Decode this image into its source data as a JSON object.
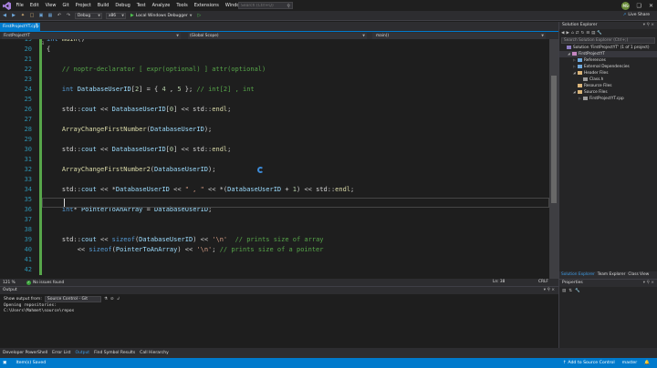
{
  "menu": {
    "items": [
      "File",
      "Edit",
      "View",
      "Git",
      "Project",
      "Build",
      "Debug",
      "Test",
      "Analyze",
      "Tools",
      "Extensions",
      "Window",
      "Help"
    ],
    "search_placeholder": "Search (Ctrl+Q)",
    "avatar_initials": "MS"
  },
  "toolbar": {
    "config": "Debug",
    "platform": "x86",
    "run_label": "Local Windows Debugger",
    "live_share": "Live Share"
  },
  "editor": {
    "tab_title": "FirstProjectYT.cpp",
    "nav_project": "FirstProjectYT",
    "nav_scope": "(Global Scope)",
    "nav_member": "main()",
    "zoom": "121 %",
    "issues": "No issues found",
    "position": "Ln: 38",
    "eol": "CRLF"
  },
  "code_lines": [
    {
      "n": "19",
      "changed": true,
      "tokens": [
        [
          "kw",
          "int "
        ],
        [
          "fn",
          "main"
        ],
        [
          "pl",
          "()"
        ]
      ]
    },
    {
      "n": "20",
      "changed": true,
      "tokens": [
        [
          "pl",
          "{"
        ]
      ]
    },
    {
      "n": "21",
      "changed": true,
      "tokens": []
    },
    {
      "n": "22",
      "changed": true,
      "tokens": [
        [
          "cmt",
          "    // noptr-declarator [ expr(optional) ] attr(optional)"
        ]
      ]
    },
    {
      "n": "23",
      "changed": true,
      "tokens": []
    },
    {
      "n": "24",
      "changed": true,
      "tokens": [
        [
          "kw",
          "    int "
        ],
        [
          "var",
          "DatabaseUserID"
        ],
        [
          "pl",
          "["
        ],
        [
          "num",
          "2"
        ],
        [
          "pl",
          "] = { "
        ],
        [
          "num",
          "4"
        ],
        [
          "pl",
          " , "
        ],
        [
          "num",
          "5"
        ],
        [
          "pl",
          " }; "
        ],
        [
          "cmt",
          "// int[2] , int"
        ]
      ]
    },
    {
      "n": "25",
      "changed": true,
      "tokens": []
    },
    {
      "n": "26",
      "changed": true,
      "tokens": [
        [
          "pl",
          "    std::"
        ],
        [
          "var",
          "cout"
        ],
        [
          "pl",
          " << "
        ],
        [
          "var",
          "DatabaseUserID"
        ],
        [
          "pl",
          "["
        ],
        [
          "num",
          "0"
        ],
        [
          "pl",
          "] << std::"
        ],
        [
          "fn",
          "endl"
        ],
        [
          "pl",
          ";"
        ]
      ]
    },
    {
      "n": "27",
      "changed": true,
      "tokens": []
    },
    {
      "n": "28",
      "changed": true,
      "tokens": [
        [
          "fn",
          "    ArrayChangeFirstNumber"
        ],
        [
          "pl",
          "("
        ],
        [
          "var",
          "DatabaseUserID"
        ],
        [
          "pl",
          ");"
        ]
      ]
    },
    {
      "n": "29",
      "changed": true,
      "tokens": []
    },
    {
      "n": "30",
      "changed": true,
      "tokens": [
        [
          "pl",
          "    std::"
        ],
        [
          "var",
          "cout"
        ],
        [
          "pl",
          " << "
        ],
        [
          "var",
          "DatabaseUserID"
        ],
        [
          "pl",
          "["
        ],
        [
          "num",
          "0"
        ],
        [
          "pl",
          "] << std::"
        ],
        [
          "fn",
          "endl"
        ],
        [
          "pl",
          ";"
        ]
      ]
    },
    {
      "n": "31",
      "changed": true,
      "tokens": []
    },
    {
      "n": "32",
      "changed": true,
      "tokens": [
        [
          "fn",
          "    ArrayChangeFirstNumber2"
        ],
        [
          "pl",
          "("
        ],
        [
          "var",
          "DatabaseUserID"
        ],
        [
          "pl",
          ");"
        ]
      ]
    },
    {
      "n": "33",
      "changed": true,
      "tokens": []
    },
    {
      "n": "34",
      "changed": true,
      "tokens": [
        [
          "pl",
          "    std::"
        ],
        [
          "var",
          "cout"
        ],
        [
          "pl",
          " << *"
        ],
        [
          "var",
          "DatabaseUserID"
        ],
        [
          "pl",
          " << "
        ],
        [
          "str",
          "\" , \""
        ],
        [
          "pl",
          " << *("
        ],
        [
          "var",
          "DatabaseUserID"
        ],
        [
          "pl",
          " + "
        ],
        [
          "num",
          "1"
        ],
        [
          "pl",
          ") << std::"
        ],
        [
          "fn",
          "endl"
        ],
        [
          "pl",
          ";"
        ]
      ]
    },
    {
      "n": "35",
      "changed": true,
      "tokens": []
    },
    {
      "n": "36",
      "changed": true,
      "tokens": [
        [
          "kw",
          "    int"
        ],
        [
          "pl",
          "* "
        ],
        [
          "var",
          "PointerToAnArray"
        ],
        [
          "pl",
          " = "
        ],
        [
          "var",
          "DatabaseUserID"
        ],
        [
          "pl",
          ";"
        ]
      ]
    },
    {
      "n": "37",
      "changed": true,
      "tokens": []
    },
    {
      "n": "38",
      "changed": true,
      "tokens": []
    },
    {
      "n": "39",
      "changed": true,
      "tokens": [
        [
          "pl",
          "    std::"
        ],
        [
          "var",
          "cout"
        ],
        [
          "pl",
          " << "
        ],
        [
          "kw",
          "sizeof"
        ],
        [
          "pl",
          "("
        ],
        [
          "var",
          "DatabaseUserID"
        ],
        [
          "pl",
          ") << "
        ],
        [
          "str",
          "'\\n'"
        ],
        [
          "pl",
          "  "
        ],
        [
          "cmt",
          "// prints size of array"
        ]
      ]
    },
    {
      "n": "40",
      "changed": true,
      "tokens": [
        [
          "pl",
          "        << "
        ],
        [
          "kw",
          "sizeof"
        ],
        [
          "pl",
          "("
        ],
        [
          "var",
          "PointerToAnArray"
        ],
        [
          "pl",
          ") << "
        ],
        [
          "str",
          "'\\n'"
        ],
        [
          "pl",
          "; "
        ],
        [
          "cmt",
          "// prints size of a pointer"
        ]
      ]
    },
    {
      "n": "41",
      "changed": true,
      "tokens": []
    },
    {
      "n": "42",
      "changed": true,
      "tokens": []
    }
  ],
  "output": {
    "title": "Output",
    "show_label": "Show output from:",
    "source": "Source Control - Git",
    "lines": [
      "Opening repositories:",
      "C:\\Users\\Mahmet\\source\\repos"
    ]
  },
  "bottom_tabs": [
    "Developer PowerShell",
    "Error List",
    "Output",
    "Find Symbol Results",
    "Call Hierarchy"
  ],
  "bottom_tabs_active": "Output",
  "status": {
    "text": "Item(s) Saved",
    "add_source": "↑ Add to Source Control",
    "branch": "master"
  },
  "solution_explorer": {
    "title": "Solution Explorer",
    "search_placeholder": "Search Solution Explorer (Ctrl+;)",
    "tree": [
      {
        "label": "Solution 'FirstProjectYT' (1 of 1 project)",
        "indent": 0,
        "arrow": "",
        "color": "#8e7cc3",
        "selected": false
      },
      {
        "label": "FirstProjectYT",
        "indent": 1,
        "arrow": "◢",
        "color": "#c586c0",
        "selected": true
      },
      {
        "label": "References",
        "indent": 2,
        "arrow": "▷",
        "color": "#6fa8dc",
        "selected": false
      },
      {
        "label": "External Dependencies",
        "indent": 2,
        "arrow": "▷",
        "color": "#6fa8dc",
        "selected": false
      },
      {
        "label": "Header Files",
        "indent": 2,
        "arrow": "◢",
        "color": "#dcb67a",
        "selected": false
      },
      {
        "label": "Class.h",
        "indent": 3,
        "arrow": "",
        "color": "#9b9b9b",
        "selected": false
      },
      {
        "label": "Resource Files",
        "indent": 2,
        "arrow": "",
        "color": "#dcb67a",
        "selected": false
      },
      {
        "label": "Source Files",
        "indent": 2,
        "arrow": "◢",
        "color": "#dcb67a",
        "selected": false
      },
      {
        "label": "FirstProjectYT.cpp",
        "indent": 3,
        "arrow": "▷",
        "color": "#9b9b9b",
        "selected": false
      }
    ],
    "tabs": [
      "Solution Explorer",
      "Team Explorer",
      "Class View"
    ],
    "active_tab": "Solution Explorer"
  },
  "properties": {
    "title": "Properties"
  }
}
